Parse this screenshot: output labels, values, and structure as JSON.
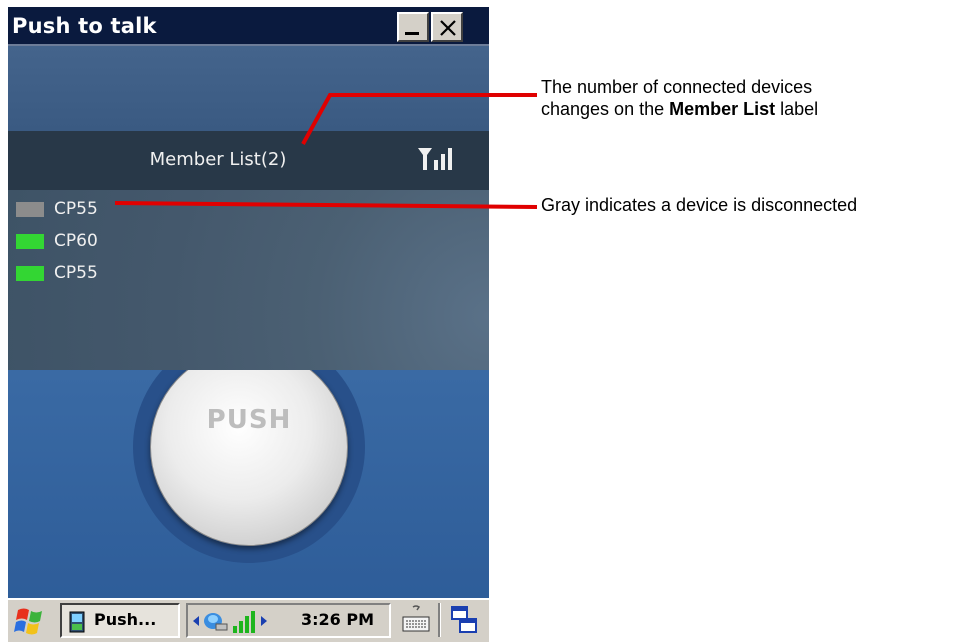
{
  "window": {
    "title": "Push to talk",
    "minimize_icon": "minimize-icon",
    "close_icon": "close-icon"
  },
  "member_bar": {
    "label": "Member List(2)",
    "signal_icon": "signal-strength-icon"
  },
  "members": [
    {
      "name": "CP55",
      "status": "disconnected",
      "color": "#8c8c8c"
    },
    {
      "name": "CP60",
      "status": "connected",
      "color": "#33d633"
    },
    {
      "name": "CP55",
      "status": "connected",
      "color": "#33d633"
    }
  ],
  "push_button": {
    "label": "PUSH"
  },
  "taskbar": {
    "start_icon": "windows-start-icon",
    "task_label": "Push...",
    "clock": "3:26 PM",
    "tray_icons": [
      "arrow-left-icon",
      "network-icon",
      "signal-bars-icon",
      "arrow-right-icon"
    ],
    "keyboard_icon": "keyboard-icon",
    "switcher_icon": "window-switcher-icon"
  },
  "annotations": {
    "member_count": {
      "line1": "The number of connected devices",
      "line2_prefix": "changes on the ",
      "line2_bold": "Member List",
      "line2_suffix": " label"
    },
    "disconnected": {
      "text": "Gray indicates a device is disconnected"
    },
    "line_color": "#e00000"
  }
}
